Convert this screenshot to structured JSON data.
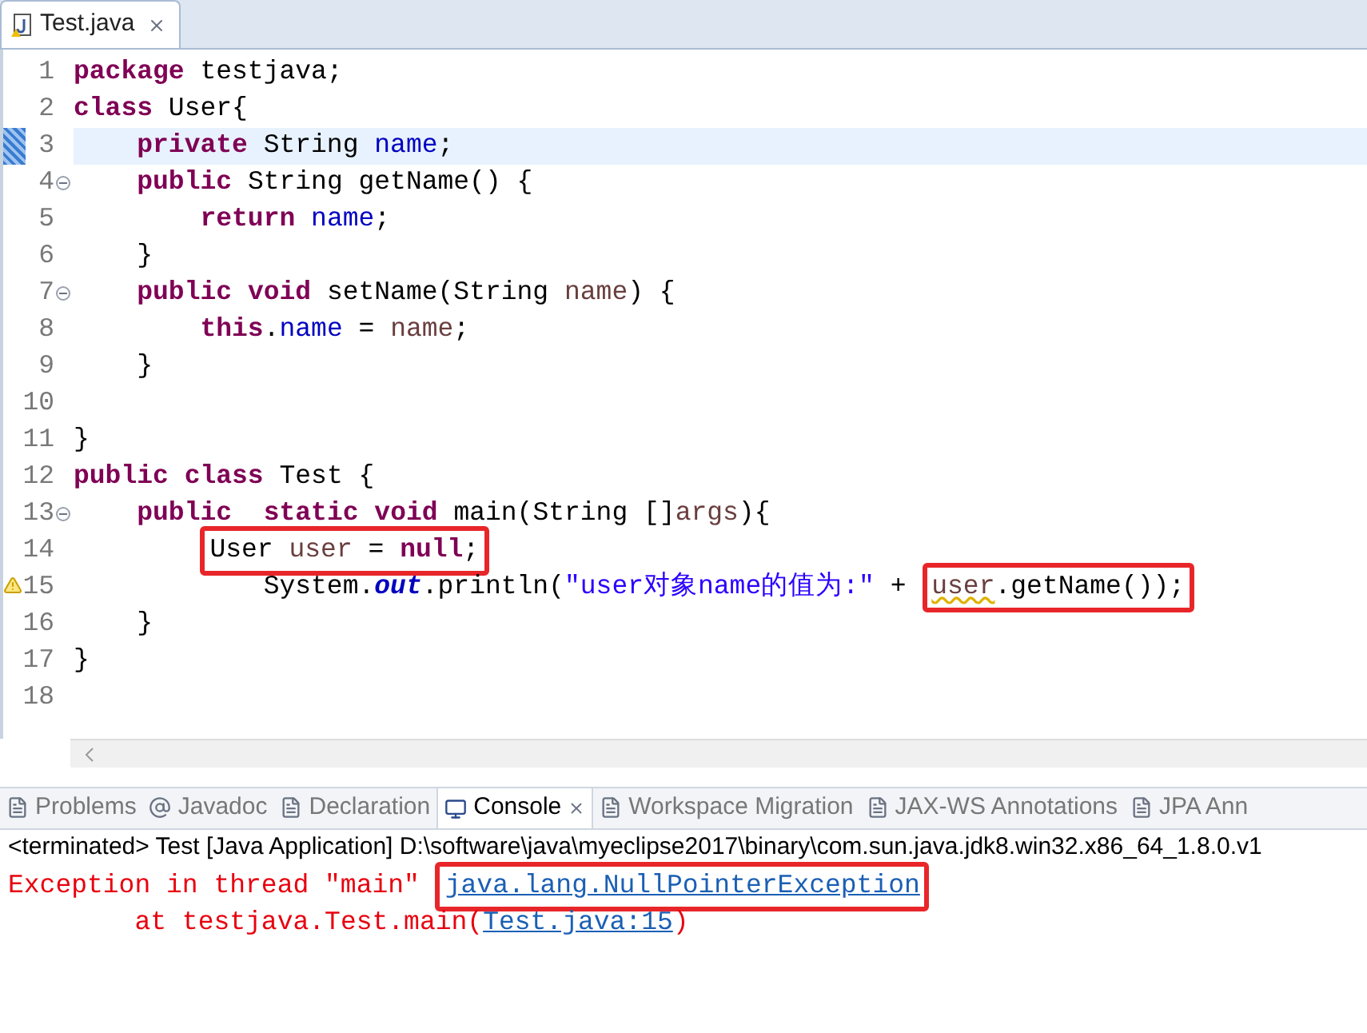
{
  "editor_tab": {
    "title": "Test.java"
  },
  "code_lines": [
    {
      "number": "1",
      "fold": false,
      "current": false,
      "warning": false,
      "tokens": [
        {
          "text": "package",
          "kind": "keyword"
        },
        {
          "text": " testjava;",
          "kind": "plain"
        }
      ]
    },
    {
      "number": "2",
      "fold": false,
      "current": false,
      "warning": false,
      "tokens": [
        {
          "text": "class",
          "kind": "keyword"
        },
        {
          "text": " User{",
          "kind": "plain"
        }
      ]
    },
    {
      "number": "3",
      "fold": false,
      "current": true,
      "warning": false,
      "tokens": [
        {
          "text": "    private",
          "kind": "keyword"
        },
        {
          "text": " String ",
          "kind": "plain"
        },
        {
          "text": "name",
          "kind": "field"
        },
        {
          "text": ";",
          "kind": "plain"
        }
      ]
    },
    {
      "number": "4",
      "fold": true,
      "current": false,
      "warning": false,
      "tokens": [
        {
          "text": "    public",
          "kind": "keyword"
        },
        {
          "text": " String getName() {",
          "kind": "plain"
        }
      ]
    },
    {
      "number": "5",
      "fold": false,
      "current": false,
      "warning": false,
      "tokens": [
        {
          "text": "        return",
          "kind": "keyword"
        },
        {
          "text": " name",
          "kind": "field"
        },
        {
          "text": ";",
          "kind": "plain"
        }
      ]
    },
    {
      "number": "6",
      "fold": false,
      "current": false,
      "warning": false,
      "tokens": [
        {
          "text": "    }",
          "kind": "plain"
        }
      ]
    },
    {
      "number": "7",
      "fold": true,
      "current": false,
      "warning": false,
      "tokens": [
        {
          "text": "    public",
          "kind": "keyword"
        },
        {
          "text": " void",
          "kind": "keyword"
        },
        {
          "text": " setName(String ",
          "kind": "plain"
        },
        {
          "text": "name",
          "kind": "local"
        },
        {
          "text": ") {",
          "kind": "plain"
        }
      ]
    },
    {
      "number": "8",
      "fold": false,
      "current": false,
      "warning": false,
      "tokens": [
        {
          "text": "        this",
          "kind": "keyword"
        },
        {
          "text": ".",
          "kind": "plain"
        },
        {
          "text": "name",
          "kind": "field"
        },
        {
          "text": " = ",
          "kind": "plain"
        },
        {
          "text": "name",
          "kind": "local"
        },
        {
          "text": ";",
          "kind": "plain"
        }
      ]
    },
    {
      "number": "9",
      "fold": false,
      "current": false,
      "warning": false,
      "tokens": [
        {
          "text": "    }",
          "kind": "plain"
        }
      ]
    },
    {
      "number": "10",
      "fold": false,
      "current": false,
      "warning": false
    },
    {
      "number": "11",
      "fold": false,
      "current": false,
      "warning": false,
      "tokens": [
        {
          "text": "}",
          "kind": "plain"
        }
      ]
    },
    {
      "number": "12",
      "fold": false,
      "current": false,
      "warning": false,
      "tokens": [
        {
          "text": "public",
          "kind": "keyword"
        },
        {
          "text": " class",
          "kind": "keyword"
        },
        {
          "text": " Test {",
          "kind": "plain"
        }
      ]
    },
    {
      "number": "13",
      "fold": true,
      "current": false,
      "warning": false,
      "tokens": [
        {
          "text": "    public",
          "kind": "keyword"
        },
        {
          "text": "  static",
          "kind": "keyword"
        },
        {
          "text": " void",
          "kind": "keyword"
        },
        {
          "text": " main(String []",
          "kind": "plain"
        },
        {
          "text": "args",
          "kind": "local"
        },
        {
          "text": "){",
          "kind": "plain"
        }
      ]
    },
    {
      "number": "14",
      "fold": false,
      "current": false,
      "warning": false,
      "boxed_tokens": [
        {
          "text": "        User ",
          "kind": "plain"
        },
        {
          "text": "user",
          "kind": "local"
        },
        {
          "text": " = ",
          "kind": "plain"
        },
        {
          "text": "null",
          "kind": "keyword"
        },
        {
          "text": ";",
          "kind": "plain"
        }
      ]
    },
    {
      "number": "15",
      "fold": false,
      "current": false,
      "warning": true,
      "tokens": [
        {
          "text": "            System.",
          "kind": "plain"
        },
        {
          "text": "out",
          "kind": "static"
        },
        {
          "text": ".println(",
          "kind": "plain"
        },
        {
          "text": "\"user对象name的值为:\"",
          "kind": "string"
        },
        {
          "text": " +",
          "kind": "plain"
        }
      ],
      "boxed_tokens": [
        {
          "text": " user",
          "kind": "local-warning"
        },
        {
          "text": ".getName());",
          "kind": "plain"
        }
      ]
    },
    {
      "number": "16",
      "fold": false,
      "current": false,
      "warning": false,
      "tokens": [
        {
          "text": "    }",
          "kind": "plain"
        }
      ]
    },
    {
      "number": "17",
      "fold": false,
      "current": false,
      "warning": false,
      "tokens": [
        {
          "text": "}",
          "kind": "plain"
        }
      ]
    },
    {
      "number": "18",
      "fold": false,
      "current": false,
      "warning": false
    }
  ],
  "panel_tabs": [
    {
      "label": "Problems",
      "selected": false
    },
    {
      "label": "Javadoc",
      "selected": false
    },
    {
      "label": "Declaration",
      "selected": false
    },
    {
      "label": "Console",
      "selected": true
    },
    {
      "label": "Workspace Migration",
      "selected": false
    },
    {
      "label": "JAX-WS Annotations",
      "selected": false
    },
    {
      "label": "JPA Ann",
      "selected": false
    }
  ],
  "console": {
    "header": "<terminated> Test [Java Application] D:\\software\\java\\myeclipse2017\\binary\\com.sun.java.jdk8.win32.x86_64_1.8.0.v1",
    "lines": [
      {
        "tokens": [
          {
            "text": "Exception in thread \"main\"",
            "kind": "error"
          }
        ],
        "boxed_tokens": [
          {
            "text": " java.lang.NullPointerException",
            "kind": "link"
          }
        ]
      },
      {
        "tokens": [
          {
            "text": "        at testjava.Test.main(",
            "kind": "error"
          },
          {
            "text": "Test.java:15",
            "kind": "link"
          },
          {
            "text": ")",
            "kind": "error"
          }
        ]
      }
    ]
  }
}
